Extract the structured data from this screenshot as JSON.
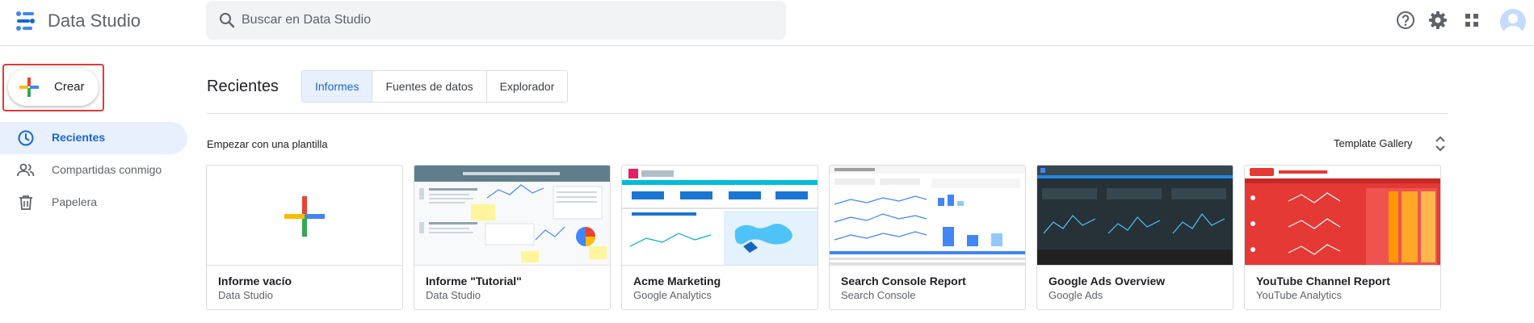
{
  "app": {
    "title": "Data Studio"
  },
  "search": {
    "placeholder": "Buscar en Data Studio"
  },
  "sidebar": {
    "create_label": "Crear",
    "items": [
      {
        "label": "Recientes",
        "icon": "clock-icon",
        "active": true
      },
      {
        "label": "Compartidas conmigo",
        "icon": "people-icon",
        "active": false
      },
      {
        "label": "Papelera",
        "icon": "trash-icon",
        "active": false
      }
    ]
  },
  "main": {
    "title": "Recientes",
    "tabs": [
      {
        "label": "Informes",
        "active": true
      },
      {
        "label": "Fuentes de datos",
        "active": false
      },
      {
        "label": "Explorador",
        "active": false
      }
    ],
    "template_heading": "Empezar con una plantilla",
    "template_gallery": "Template Gallery",
    "templates": [
      {
        "name": "Informe vacío",
        "source": "Data Studio"
      },
      {
        "name": "Informe \"Tutorial\"",
        "source": "Data Studio"
      },
      {
        "name": "Acme Marketing",
        "source": "Google Analytics"
      },
      {
        "name": "Search Console Report",
        "source": "Search Console"
      },
      {
        "name": "Google Ads Overview",
        "source": "Google Ads"
      },
      {
        "name": "YouTube Channel Report",
        "source": "YouTube Analytics"
      }
    ]
  },
  "colors": {
    "accent": "#1967d2",
    "active_bg": "#e8f0fe",
    "highlight": "#e53935"
  }
}
